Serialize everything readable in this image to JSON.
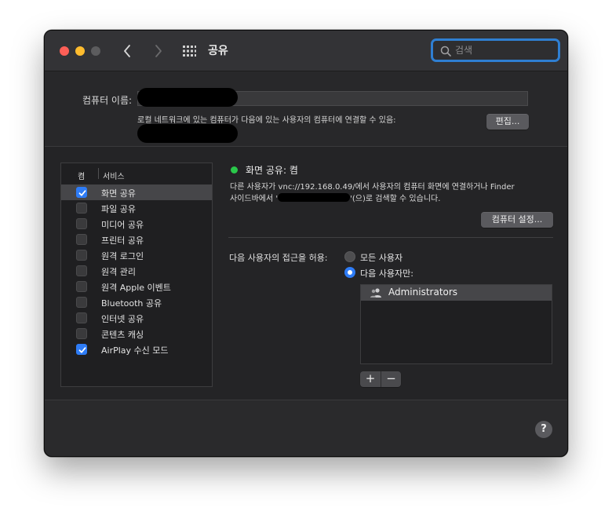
{
  "window": {
    "title": "공유",
    "search": {
      "placeholder": "검색",
      "value": ""
    }
  },
  "computer": {
    "name_label": "컴퓨터 이름:",
    "local_network_text": "로컬 네트워크에 있는 컴퓨터가 다음에 있는 사용자의 컴퓨터에 연결할 수 있음:",
    "edit_button": "편집..."
  },
  "services": {
    "header_on": "켬",
    "header_service": "서비스",
    "items": [
      {
        "label": "화면 공유",
        "checked": true,
        "selected": true
      },
      {
        "label": "파일 공유",
        "checked": false
      },
      {
        "label": "미디어 공유",
        "checked": false
      },
      {
        "label": "프린터 공유",
        "checked": false
      },
      {
        "label": "원격 로그인",
        "checked": false
      },
      {
        "label": "원격 관리",
        "checked": false
      },
      {
        "label": "원격 Apple 이벤트",
        "checked": false
      },
      {
        "label": "Bluetooth 공유",
        "checked": false
      },
      {
        "label": "인터넷 공유",
        "checked": false
      },
      {
        "label": "콘텐츠 캐싱",
        "checked": false
      },
      {
        "label": "AirPlay 수신 모드",
        "checked": true
      }
    ]
  },
  "detail": {
    "status_title": "화면 공유: 켬",
    "status_color": "#2ac84a",
    "desc_line1": "다른 사용자가 vnc://192.168.0.49/에서 사용자의 컴퓨터 화면에 연결하거나 Finder",
    "desc_line2_prefix": "사이드바에서 '",
    "desc_line2_suffix": "'(으)로 검색할 수 있습니다.",
    "settings_button": "컴퓨터 설정...",
    "access_label": "다음 사용자의 접근을 허용:",
    "radio_all": "모든 사용자",
    "radio_only": "다음 사용자만:",
    "radio_selected": "only",
    "users": [
      "Administrators"
    ],
    "add_button": "+",
    "remove_button": "−"
  },
  "help_button": "?",
  "colors": {
    "accent": "#2e7cf6",
    "search_focus": "#2f7fd2"
  }
}
